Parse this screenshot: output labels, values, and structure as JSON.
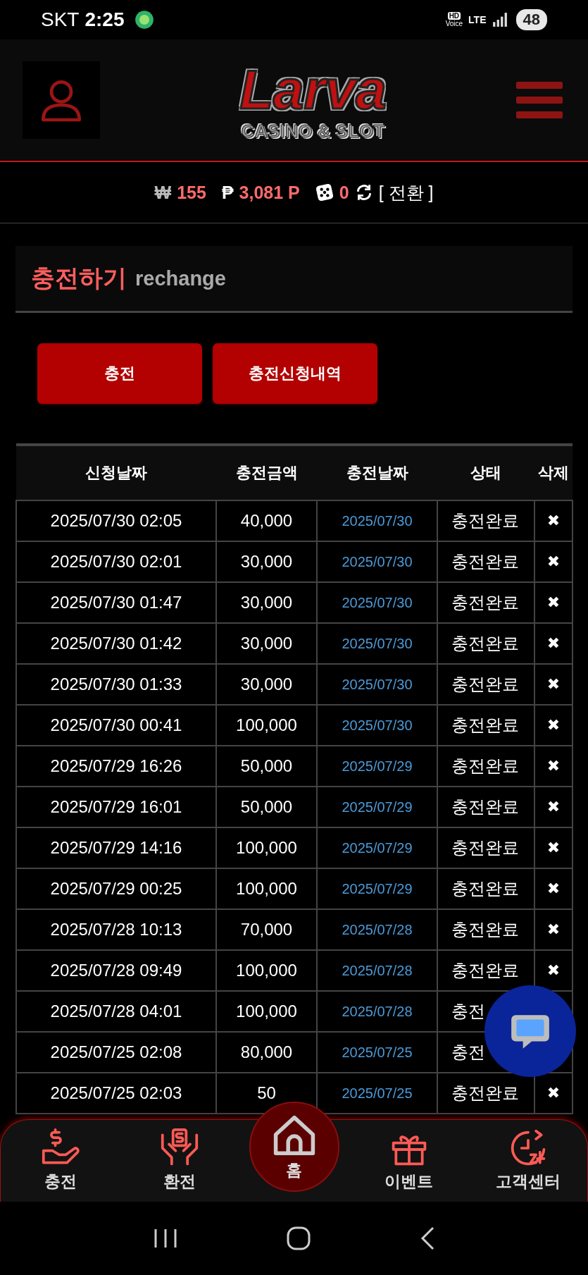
{
  "status_bar": {
    "carrier": "SKT",
    "time": "2:25",
    "hd_label": "HD",
    "voice_label": "Voice",
    "network": "LTE",
    "battery": "48"
  },
  "header": {
    "logo_title": "Larva",
    "logo_subtitle": "CASINO & SLOT"
  },
  "balance": {
    "won_symbol": "₩",
    "cash": "155",
    "point_symbol": "₱",
    "points": "3,081 P",
    "chips": "0",
    "convert": "[ 전환 ]"
  },
  "section": {
    "title": "충전하기",
    "subtitle": "rechange"
  },
  "actions": [
    {
      "label": "충전"
    },
    {
      "label": "충전신청내역"
    }
  ],
  "table": {
    "columns": [
      "신청날짜",
      "충전금액",
      "충전날짜",
      "상태",
      "삭제"
    ],
    "rows": [
      {
        "requested": "2025/07/30 02:05",
        "amount": "40,000",
        "charged": "2025/07/30",
        "status": "충전완료",
        "delete": "✖"
      },
      {
        "requested": "2025/07/30 02:01",
        "amount": "30,000",
        "charged": "2025/07/30",
        "status": "충전완료",
        "delete": "✖"
      },
      {
        "requested": "2025/07/30 01:47",
        "amount": "30,000",
        "charged": "2025/07/30",
        "status": "충전완료",
        "delete": "✖"
      },
      {
        "requested": "2025/07/30 01:42",
        "amount": "30,000",
        "charged": "2025/07/30",
        "status": "충전완료",
        "delete": "✖"
      },
      {
        "requested": "2025/07/30 01:33",
        "amount": "30,000",
        "charged": "2025/07/30",
        "status": "충전완료",
        "delete": "✖"
      },
      {
        "requested": "2025/07/30 00:41",
        "amount": "100,000",
        "charged": "2025/07/30",
        "status": "충전완료",
        "delete": "✖"
      },
      {
        "requested": "2025/07/29 16:26",
        "amount": "50,000",
        "charged": "2025/07/29",
        "status": "충전완료",
        "delete": "✖"
      },
      {
        "requested": "2025/07/29 16:01",
        "amount": "50,000",
        "charged": "2025/07/29",
        "status": "충전완료",
        "delete": "✖"
      },
      {
        "requested": "2025/07/29 14:16",
        "amount": "100,000",
        "charged": "2025/07/29",
        "status": "충전완료",
        "delete": "✖"
      },
      {
        "requested": "2025/07/29 00:25",
        "amount": "100,000",
        "charged": "2025/07/29",
        "status": "충전완료",
        "delete": "✖"
      },
      {
        "requested": "2025/07/28 10:13",
        "amount": "70,000",
        "charged": "2025/07/28",
        "status": "충전완료",
        "delete": "✖"
      },
      {
        "requested": "2025/07/28 09:49",
        "amount": "100,000",
        "charged": "2025/07/28",
        "status": "충전완료",
        "delete": "✖"
      },
      {
        "requested": "2025/07/28 04:01",
        "amount": "100,000",
        "charged": "2025/07/28",
        "status": "충전"
      },
      {
        "requested": "2025/07/25 02:08",
        "amount": "80,000",
        "charged": "2025/07/25",
        "status": "충전"
      },
      {
        "requested": "2025/07/25 02:03",
        "amount": "50",
        "charged": "2025/07/25",
        "status": "충전완료",
        "delete": "✖"
      }
    ]
  },
  "bottom_nav": [
    {
      "label": "충전",
      "kind": "tab"
    },
    {
      "label": "환전",
      "kind": "tab"
    },
    {
      "label": "홈",
      "kind": "center"
    },
    {
      "label": "이벤트",
      "kind": "tab"
    },
    {
      "label": "고객센터",
      "kind": "tab"
    }
  ]
}
